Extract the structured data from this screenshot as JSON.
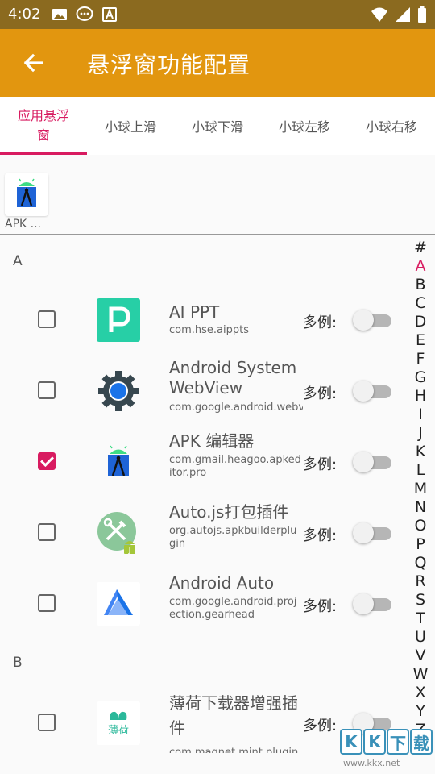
{
  "status_bar": {
    "time": "4:02",
    "icons": [
      "image-icon",
      "message-icon",
      "a-icon"
    ],
    "right_icons": [
      "wifi-icon",
      "signal-icon",
      "battery-icon"
    ]
  },
  "app_bar": {
    "title": "悬浮窗功能配置",
    "back_icon": "arrow-back-icon",
    "color": "#E2960F"
  },
  "tabs": [
    {
      "label": "应用悬浮窗",
      "active": true
    },
    {
      "label": "小球上滑",
      "active": false
    },
    {
      "label": "小球下滑",
      "active": false
    },
    {
      "label": "小球左移",
      "active": false
    },
    {
      "label": "小球右移",
      "active": false
    }
  ],
  "accent_color": "#D81B60",
  "selected_apps": [
    {
      "label": "APK ...",
      "icon": "apk-editor-icon"
    }
  ],
  "sections": [
    {
      "header": "A",
      "apps": [
        {
          "name": "AI PPT",
          "package": "com.hse.aippts",
          "checked": false,
          "multi_label": "多例:",
          "multi_enabled": false,
          "icon": "aippt-icon"
        },
        {
          "name": "Android System WebView",
          "package": "com.google.android.webvi",
          "checked": false,
          "multi_label": "多例:",
          "multi_enabled": false,
          "icon": "webview-gear-icon"
        },
        {
          "name": "APK 编辑器",
          "package": "com.gmail.heagoo.apkeditor.pro",
          "checked": true,
          "multi_label": "多例:",
          "multi_enabled": false,
          "icon": "apk-editor-icon"
        },
        {
          "name": "Auto.js打包插件",
          "package": "org.autojs.apkbuilderplugin",
          "checked": false,
          "multi_label": "多例:",
          "multi_enabled": false,
          "icon": "autojs-plugin-icon"
        },
        {
          "name": "Android Auto",
          "package": "com.google.android.projection.gearhead",
          "checked": false,
          "multi_label": "多例:",
          "multi_enabled": false,
          "icon": "android-auto-icon"
        }
      ]
    },
    {
      "header": "B",
      "apps": [
        {
          "name": "薄荷下载器增强插件",
          "package": "com.magnet.mint.pluginx",
          "checked": false,
          "multi_label": "多例:",
          "multi_enabled": false,
          "icon": "mint-icon",
          "icon_text": "薄荷"
        }
      ]
    }
  ],
  "index_letters": [
    "#",
    "A",
    "B",
    "C",
    "D",
    "E",
    "F",
    "G",
    "H",
    "I",
    "J",
    "K",
    "L",
    "M",
    "N",
    "O",
    "P",
    "Q",
    "R",
    "S",
    "T",
    "U",
    "V",
    "W",
    "X",
    "Y",
    "Z"
  ],
  "index_active": "A",
  "watermark": {
    "letters": [
      "K",
      "K",
      "下",
      "载"
    ],
    "url": "www.kkx.net"
  }
}
